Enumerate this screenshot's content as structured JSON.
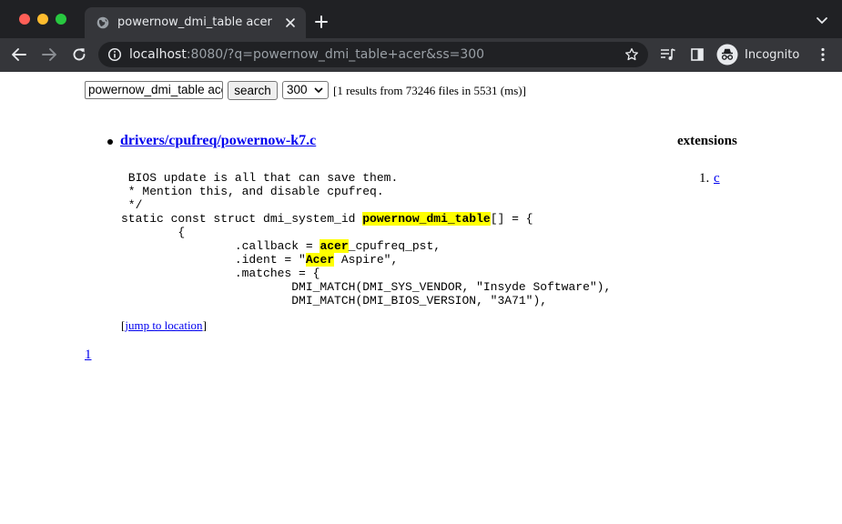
{
  "browser": {
    "tab_title": "powernow_dmi_table acer",
    "url_host": "localhost",
    "url_rest": ":8080/?q=powernow_dmi_table+acer&ss=300",
    "profile_label": "Incognito",
    "icons": [
      "globe-icon",
      "close-icon",
      "plus-icon",
      "chevron-down-icon",
      "back-arrow-icon",
      "forward-arrow-icon",
      "reload-icon",
      "info-icon",
      "star-icon",
      "media-queue-icon",
      "side-panel-icon",
      "incognito-icon",
      "kebab-menu-icon"
    ]
  },
  "search": {
    "query": "powernow_dmi_table acer",
    "button_label": "search",
    "page_size": "300",
    "summary": "[1 results from 73246 files in 5531 (ms)]"
  },
  "result": {
    "path": "drivers/cpufreq/powernow-k7.c",
    "snippet": [
      [
        {
          "t": " BIOS update is all that can save them."
        }
      ],
      [
        {
          "t": " * Mention this, and disable cpufreq."
        }
      ],
      [
        {
          "t": " */"
        }
      ],
      [
        {
          "t": "static const struct dmi_system_id "
        },
        {
          "t": "powernow_dmi_table",
          "hl": true
        },
        {
          "t": "[] = {"
        }
      ],
      [
        {
          "t": "        {"
        }
      ],
      [
        {
          "t": "                .callback = "
        },
        {
          "t": "acer",
          "hl": true
        },
        {
          "t": "_cpufreq_pst,"
        }
      ],
      [
        {
          "t": "                .ident = \""
        },
        {
          "t": "Acer",
          "hl": true
        },
        {
          "t": " Aspire\","
        }
      ],
      [
        {
          "t": "                .matches = {"
        }
      ],
      [
        {
          "t": "                        DMI_MATCH(DMI_SYS_VENDOR, \"Insyde Software\"),"
        }
      ],
      [
        {
          "t": "                        DMI_MATCH(DMI_BIOS_VERSION, \"3A71\"),"
        }
      ]
    ],
    "jump_open": "[",
    "jump_label": "jump to location",
    "jump_close": "]"
  },
  "pagination": {
    "current": "1"
  },
  "extensions": {
    "heading": "extensions",
    "items": [
      {
        "num": "1.",
        "label": "c"
      }
    ]
  },
  "colors": {
    "highlight": "#ffff00",
    "link": "#0000ee",
    "chrome_dark": "#202124",
    "chrome_toolbar": "#35363a"
  }
}
